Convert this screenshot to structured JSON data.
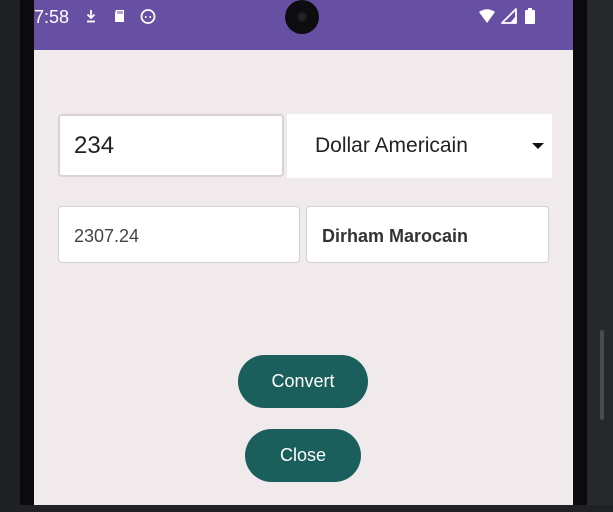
{
  "status_bar": {
    "time": "7:58",
    "left_icons": [
      "download-arrow-icon",
      "sd-card-icon",
      "android-face-icon"
    ],
    "right_icons": [
      "wifi-icon",
      "cell-signal-icon",
      "battery-icon"
    ],
    "background_color": "#6750a4"
  },
  "converter": {
    "amount_value": "234",
    "source_currency": "Dollar Americain",
    "result_value": "2307.24",
    "target_currency": "Dirham Marocain"
  },
  "buttons": {
    "convert_label": "Convert",
    "close_label": "Close",
    "color": "#1b5f5c"
  }
}
